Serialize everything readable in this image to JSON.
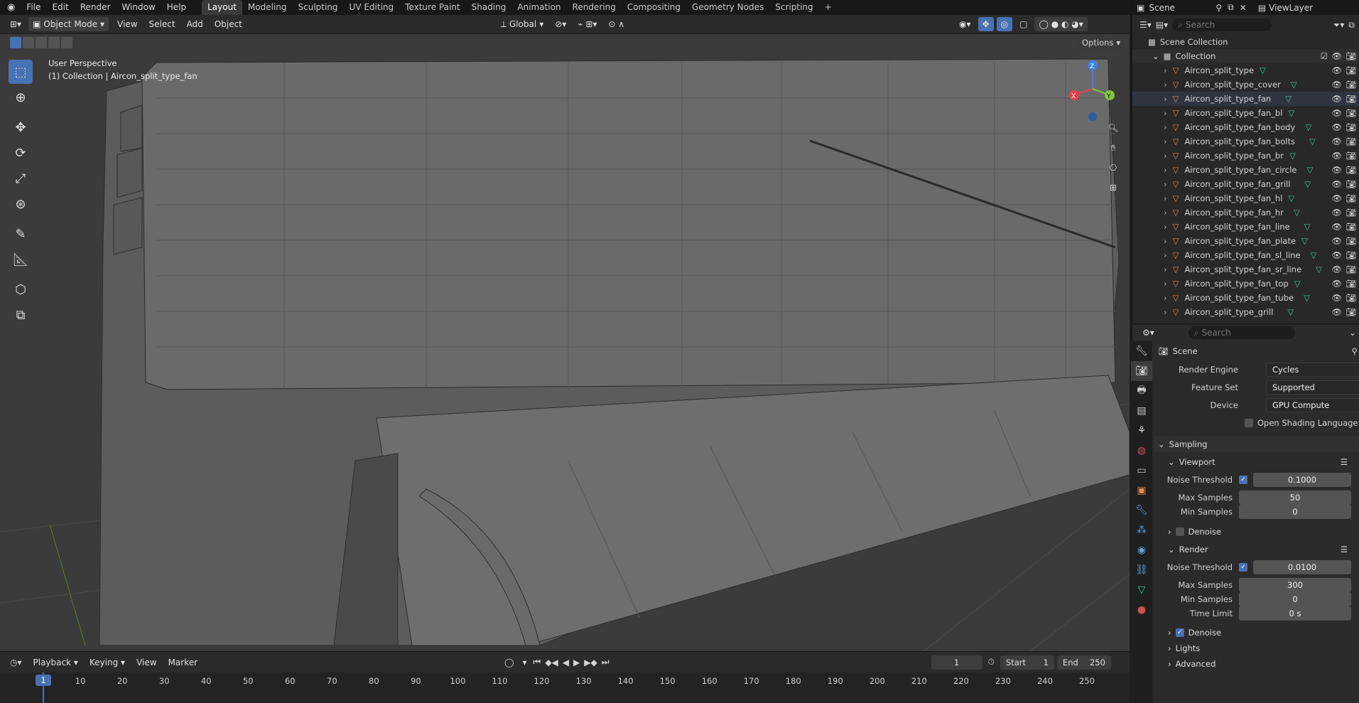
{
  "topbar": {
    "menus": [
      "File",
      "Edit",
      "Render",
      "Window",
      "Help"
    ],
    "workspaces": [
      "Layout",
      "Modeling",
      "Sculpting",
      "UV Editing",
      "Texture Paint",
      "Shading",
      "Animation",
      "Rendering",
      "Compositing",
      "Geometry Nodes",
      "Scripting"
    ],
    "active_workspace": "Layout",
    "add_tab": "+",
    "scene": "Scene",
    "view_layer": "ViewLayer"
  },
  "viewport_header": {
    "mode": "Object Mode",
    "menus": [
      "View",
      "Select",
      "Add",
      "Object"
    ],
    "transform_orientation": "Global",
    "options": "Options"
  },
  "viewport": {
    "view_name": "User Perspective",
    "collection_info": "(1) Collection | Aircon_split_type_fan",
    "gizmo_axes": [
      "Z",
      "Y",
      "X"
    ]
  },
  "outliner": {
    "search_placeholder": "Search",
    "scene_collection": "Scene Collection",
    "collection": "Collection",
    "objects": [
      "Aircon_split_type",
      "Aircon_split_type_cover",
      "Aircon_split_type_fan",
      "Aircon_split_type_fan_bl",
      "Aircon_split_type_fan_body",
      "Aircon_split_type_fan_bolts",
      "Aircon_split_type_fan_br",
      "Aircon_split_type_fan_circle",
      "Aircon_split_type_fan_grill",
      "Aircon_split_type_fan_hl",
      "Aircon_split_type_fan_hr",
      "Aircon_split_type_fan_line",
      "Aircon_split_type_fan_plate",
      "Aircon_split_type_fan_sl_line",
      "Aircon_split_type_fan_sr_line",
      "Aircon_split_type_fan_top",
      "Aircon_split_type_fan_tube",
      "Aircon_split_type_grill"
    ]
  },
  "properties": {
    "search_placeholder": "Search",
    "context": "Scene",
    "render_engine_label": "Render Engine",
    "render_engine": "Cycles",
    "feature_set_label": "Feature Set",
    "feature_set": "Supported",
    "device_label": "Device",
    "device": "GPU Compute",
    "osl_label": "Open Shading Language",
    "sampling": "Sampling",
    "viewport": {
      "title": "Viewport",
      "noise_threshold_label": "Noise Threshold",
      "noise_threshold": "0.1000",
      "max_samples_label": "Max Samples",
      "max_samples": "50",
      "min_samples_label": "Min Samples",
      "min_samples": "0",
      "denoise": "Denoise"
    },
    "render": {
      "title": "Render",
      "noise_threshold_label": "Noise Threshold",
      "noise_threshold": "0.0100",
      "max_samples_label": "Max Samples",
      "max_samples": "300",
      "min_samples_label": "Min Samples",
      "min_samples": "0",
      "time_limit_label": "Time Limit",
      "time_limit": "0 s",
      "denoise": "Denoise"
    },
    "lights": "Lights",
    "advanced": "Advanced"
  },
  "timeline": {
    "menus": [
      "Playback",
      "Keying",
      "View",
      "Marker"
    ],
    "current_frame": "1",
    "start_label": "Start",
    "start": "1",
    "end_label": "End",
    "end": "250",
    "ticks": [
      "1",
      "10",
      "20",
      "30",
      "40",
      "50",
      "60",
      "70",
      "80",
      "90",
      "100",
      "110",
      "120",
      "130",
      "140",
      "150",
      "160",
      "170",
      "180",
      "190",
      "200",
      "210",
      "220",
      "230",
      "240",
      "250"
    ]
  },
  "colors": {
    "accent": "#4772b3",
    "mesh_icon": "#e8874a",
    "data_icon": "#3ec79a",
    "axis_x": "#e8414c",
    "axis_y": "#7fc53b",
    "axis_z": "#3b82e8"
  }
}
